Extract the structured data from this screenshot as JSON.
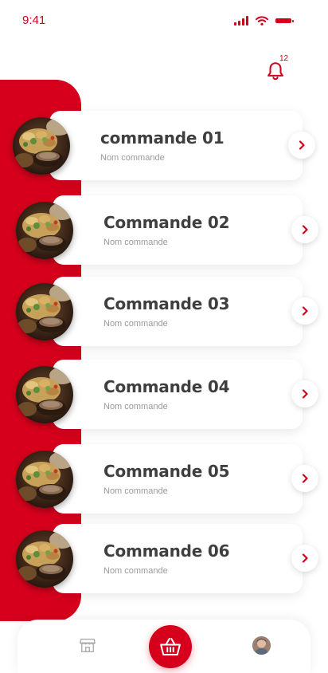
{
  "status_bar": {
    "time": "9:41",
    "icons": [
      "signal-icon",
      "wifi-icon",
      "battery-icon"
    ],
    "color": "#d0021b"
  },
  "header": {
    "notification_icon": "bell-icon",
    "notification_count": "12"
  },
  "orders": [
    {
      "title": "commande 01",
      "subtitle": "Nom commande",
      "icon": "chevron-right-icon"
    },
    {
      "title": "Commande 02",
      "subtitle": "Nom commande",
      "icon": "chevron-right-icon"
    },
    {
      "title": "Commande 03",
      "subtitle": "Nom commande",
      "icon": "chevron-right-icon"
    },
    {
      "title": "Commande 04",
      "subtitle": "Nom commande",
      "icon": "chevron-right-icon"
    },
    {
      "title": "Commande 05",
      "subtitle": "Nom commande",
      "icon": "chevron-right-icon"
    },
    {
      "title": "Commande 06",
      "subtitle": "Nom commande",
      "icon": "chevron-right-icon"
    }
  ],
  "bottom_nav": {
    "items": [
      {
        "icon": "store-icon"
      },
      {
        "icon": "basket-icon",
        "active": true
      },
      {
        "icon": "avatar"
      }
    ]
  },
  "colors": {
    "accent": "#d6001c",
    "title_text": "#3f3f3f",
    "subtitle_text": "#9a9a9a",
    "card_background": "#ffffff"
  }
}
